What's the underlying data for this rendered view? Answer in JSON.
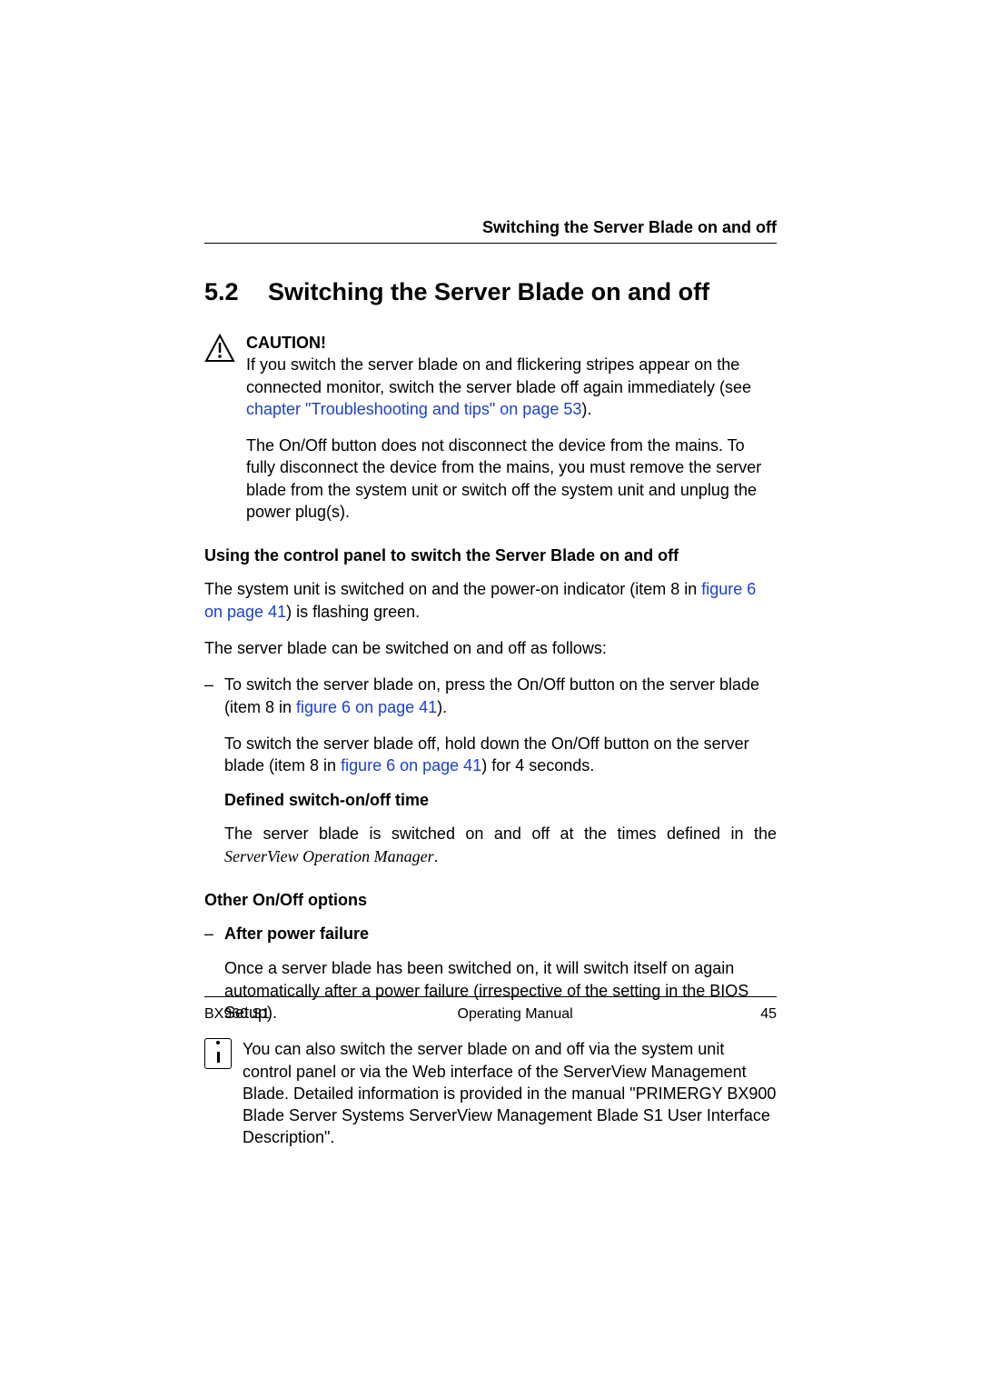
{
  "header": {
    "running_head": "Switching the Server Blade on and off"
  },
  "section": {
    "number": "5.2",
    "title": "Switching the Server Blade on and off"
  },
  "caution": {
    "label": "CAUTION!",
    "p1_a": "If you switch the server blade on and flickering stripes appear on the connected monitor, switch the server blade off again immediately (see ",
    "link1": "chapter \"Troubleshooting and tips\" on page 53",
    "p1_b": ").",
    "p2": "The On/Off button does not disconnect the device from the mains. To fully disconnect the device from the mains, you must remove the server blade from the system unit or switch off the system unit and unplug the power plug(s)."
  },
  "using": {
    "heading": "Using the control panel to switch the Server Blade on and off",
    "p1_a": "The system unit is switched on and the power-on indicator (item 8 in ",
    "link1": "figure 6 on page 41",
    "p1_b": ") is flashing green.",
    "p2": "The server blade can be switched on and off as follows:",
    "bullet1_a": "To switch the server blade on, press the On/Off button on the server blade (item 8 in ",
    "bullet1_link": "figure 6 on page 41",
    "bullet1_b": ").",
    "bullet1_p2_a": "To switch the server blade off, hold down the On/Off button on the server blade (item 8 in ",
    "bullet1_p2_link": "figure 6 on page 41",
    "bullet1_p2_b": ") for 4 seconds.",
    "defined_heading": "Defined switch-on/off time",
    "defined_p_a": "The server blade is switched on and off at the times defined in the ",
    "defined_p_em": "ServerView Operation Manager",
    "defined_p_b": "."
  },
  "other": {
    "heading": "Other On/Off options",
    "item1_label": "After power failure",
    "item1_body": "Once a server blade has been switched on, it will switch itself on again automatically after a power failure (irrespective of the setting in the BIOS Setup)."
  },
  "info": {
    "body": "You can also switch the server blade on and off via the system unit control panel or via the Web interface of the ServerView Management Blade. Detailed information is provided in the manual \"PRIMERGY BX900 Blade Server Systems ServerView Management Blade S1 User Interface Description\"."
  },
  "footer": {
    "left": "BX960 S1",
    "center": "Operating Manual",
    "right": "45"
  }
}
